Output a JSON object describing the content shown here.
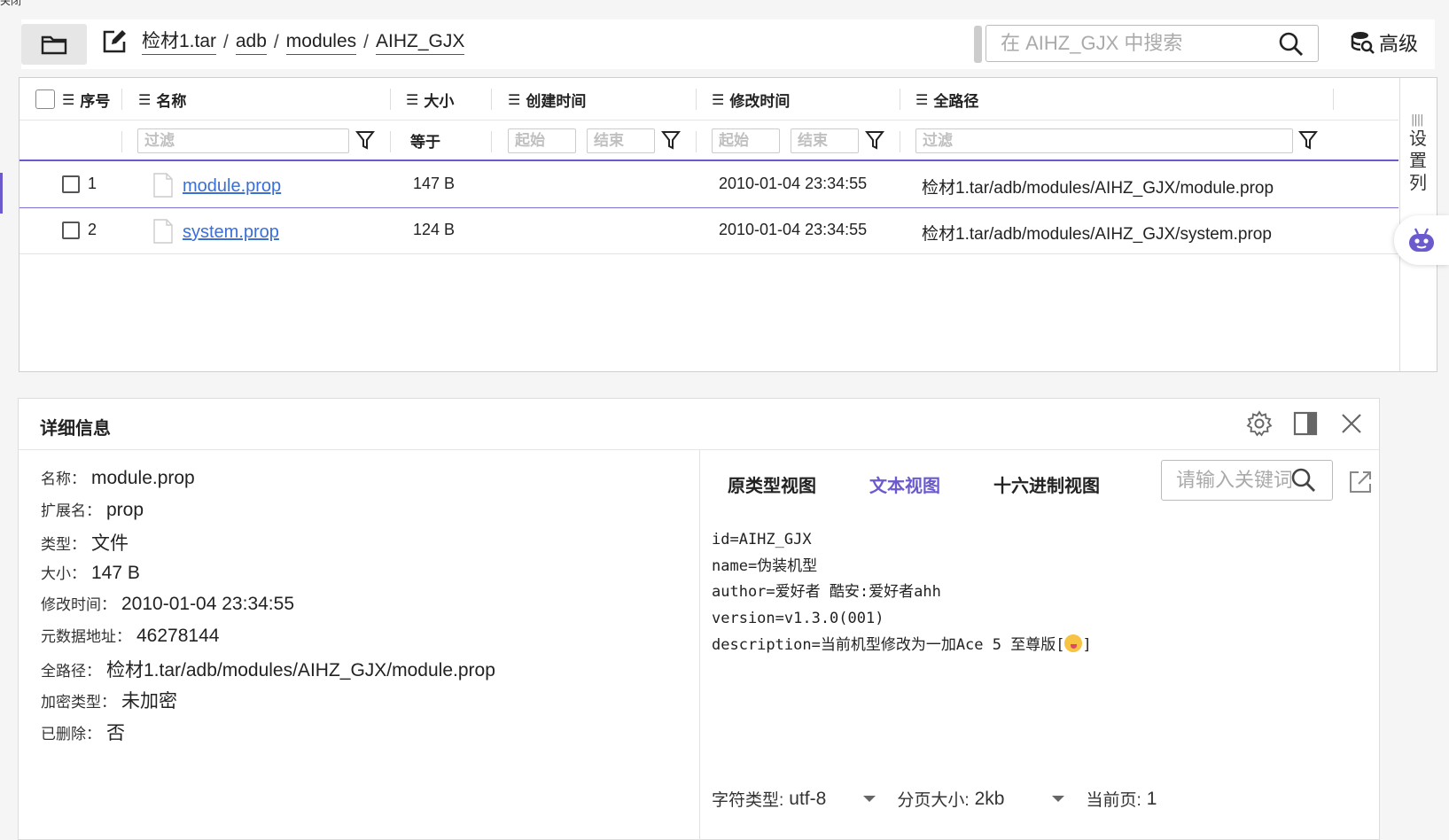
{
  "top_label": "关闭",
  "toolbar": {
    "breadcrumbs": [
      "检材1.tar",
      "adb",
      "modules",
      "AIHZ_GJX"
    ],
    "search_placeholder": "在 AIHZ_GJX 中搜索",
    "advanced_label": "高级"
  },
  "table": {
    "columns": {
      "index": "序号",
      "name": "名称",
      "size": "大小",
      "created": "创建时间",
      "modified": "修改时间",
      "path": "全路径"
    },
    "filters": {
      "name": "过滤",
      "size": "等于",
      "created_start": "起始",
      "created_end": "结束",
      "modified_start": "起始",
      "modified_end": "结束",
      "path": "过滤"
    },
    "side_label": "设置列",
    "rows": [
      {
        "index": "1",
        "name": "module.prop",
        "size": "147 B",
        "modified": "2010-01-04 23:34:55",
        "path": "检材1.tar/adb/modules/AIHZ_GJX/module.prop"
      },
      {
        "index": "2",
        "name": "system.prop",
        "size": "124 B",
        "modified": "2010-01-04 23:34:55",
        "path": "检材1.tar/adb/modules/AIHZ_GJX/system.prop"
      }
    ]
  },
  "detail": {
    "title": "详细信息",
    "fields": [
      {
        "k": "名称：",
        "v": "module.prop"
      },
      {
        "k": "扩展名：",
        "v": "prop"
      },
      {
        "k": "类型：",
        "v": "文件"
      },
      {
        "k": "大小：",
        "v": "147 B"
      },
      {
        "k": "修改时间：",
        "v": "2010-01-04 23:34:55"
      },
      {
        "k": "元数据地址：",
        "v": "46278144"
      },
      {
        "k": "全路径：",
        "v": "检材1.tar/adb/modules/AIHZ_GJX/module.prop"
      },
      {
        "k": "加密类型：",
        "v": "未加密"
      },
      {
        "k": "已删除：",
        "v": "否"
      }
    ],
    "tabs": [
      "原类型视图",
      "文本视图",
      "十六进制视图"
    ],
    "active_tab": "文本视图",
    "keyword_placeholder": "请输入关键词",
    "content_lines": [
      "id=AIHZ_GJX",
      "name=伪装机型",
      "author=爱好者 酷安:爱好者ahh",
      "version=v1.3.0(001)",
      "description=当前机型修改为一加Ace 5 至尊版["
    ],
    "content_tail": "]",
    "footer": {
      "charset_label": "字符类型:",
      "charset_value": "utf-8",
      "pagesize_label": "分页大小:",
      "pagesize_value": "2kb",
      "page_label": "当前页:",
      "page_value": "1"
    }
  },
  "colors": {
    "accent": "#6a5acd",
    "link": "#3a6fd8"
  }
}
